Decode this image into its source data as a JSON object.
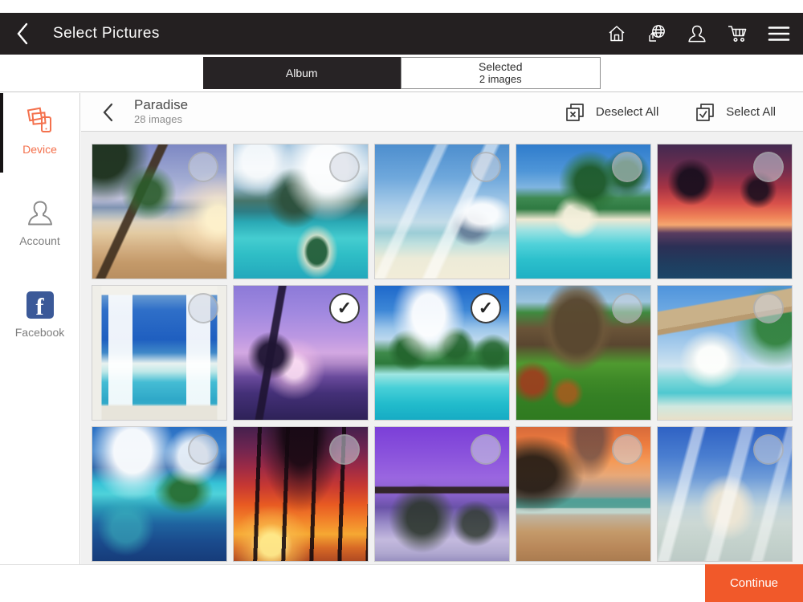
{
  "colors": {
    "accent": "#f1592a",
    "device_orange": "#f4714d",
    "facebook_blue": "#3b5998",
    "header_bg": "#242021",
    "grid_bg": "#f1f1f1"
  },
  "header": {
    "title": "Select Pictures",
    "icons": [
      "back-chevron-icon",
      "home-icon",
      "globe-upload-icon",
      "account-icon",
      "cart-icon",
      "menu-icon"
    ]
  },
  "tabs": {
    "album": {
      "label": "Album",
      "active": true
    },
    "selected": {
      "label": "Selected",
      "sublabel": "2 images",
      "active": false
    }
  },
  "sidebar": {
    "items": [
      {
        "label": "Device",
        "icon": "device-photos-icon",
        "active": true
      },
      {
        "label": "Account",
        "icon": "person-icon",
        "active": false
      },
      {
        "label": "Facebook",
        "icon": "facebook-icon",
        "active": false
      }
    ],
    "facebook_glyph": "f"
  },
  "album": {
    "name": "Paradise",
    "count_label": "28 images",
    "deselect_all_label": "Deselect All",
    "select_all_label": "Select All"
  },
  "grid": {
    "check_glyph": "✓",
    "selected_count": 2,
    "visible_count": 15
  },
  "footer": {
    "continue_label": "Continue"
  },
  "photos": [
    {
      "id": "palm-beach-sunrise",
      "alt": "palm tree leaning over golden beach",
      "selected": false,
      "bg": "radial-gradient(circle at 8% 8%, rgba(28,48,26,0.95) 0 13%, rgba(32,62,32,0.6) 18%, transparent 27%), radial-gradient(circle at 42% 36%, rgba(42,92,42,0.9) 0 10%, rgba(52,112,52,0.5) 16%, transparent 24%), linear-gradient(115deg, transparent 0 33%, rgba(62,46,30,0.9) 34% 38%, transparent 39%), radial-gradient(circle at 94% 55%, rgba(255,242,204,0.95) 0 8%, rgba(255,230,190,0.5) 18%, transparent 32%), linear-gradient(180deg, #7d88c4 0%, #a0aad2 25%, #c4c4de 40%, #8094b2 47%, #aab6c0 52%, #ded2bd 58%, #e3cba2 66%, #d5b286 76%, #c49a6a 88%, #b98f60 100%)"
    },
    {
      "id": "bora-bora-lagoon",
      "alt": "green mountain over turquoise lagoon",
      "selected": false,
      "bg": "radial-gradient(ellipse at 70% 18%, rgba(255,255,255,0.95) 0 15%, rgba(255,255,255,0.5) 24%, transparent 34%), radial-gradient(ellipse at 18% 12%, rgba(255,255,255,0.85) 0 10%, transparent 22%), radial-gradient(ellipse at 45% 40%, rgba(45,80,60,0.95) 0 12%, rgba(50,90,70,0.7) 18%, transparent 27%), radial-gradient(ellipse at 62% 80%, rgba(40,90,50,0.9) 0 8%, rgba(232,226,200,0.8) 11%, transparent 18%), linear-gradient(180deg, #9cc0dc 0%, #cfe0ec 18%, #8fb4c8 32%, #47756a 42%, #2e7d85 50%, #2aa9b5 58%, #45cdd0 70%, #2fbec6 82%, #23a8bc 100%)"
    },
    {
      "id": "beach-with-boat",
      "alt": "bright sky, distant hills, pale sand and boat",
      "selected": false,
      "bg": "linear-gradient(115deg, transparent 0 30%, rgba(255,255,255,0.5) 32% 36%, transparent 38% 55%, rgba(255,255,255,0.6) 57% 62%, transparent 64%), radial-gradient(ellipse at 80% 52%, rgba(255,255,255,0.9) 0 10%, transparent 20%), radial-gradient(ellipse at 72% 62%, rgba(92,112,142,0.8) 0 8%, transparent 16%), linear-gradient(180deg, #4d8ece 0%, #6fa8dc 25%, #a7cbe8 45%, #c3dce8 58%, #9ccdd6 66%, #bfe0de 74%, #ecebd8 85%, #f2ecd8 100%)"
    },
    {
      "id": "island-palms",
      "alt": "palms over white sand island and clear water",
      "selected": false,
      "bg": "radial-gradient(circle at 55% 28%, rgba(30,90,40,0.95) 0 12%, rgba(40,110,50,0.6) 18%, transparent 26%), radial-gradient(circle at 82% 22%, rgba(30,90,40,0.9) 0 8%, transparent 16%), radial-gradient(ellipse at 45% 54%, rgba(245,240,220,0.95) 0 12%, transparent 22%), linear-gradient(180deg, #2f7ccc 0%, #4f96d8 20%, #7fb4e0 32%, #3f8a52 40%, #2f7a42 48%, #eee8d2 56%, #9fe2e2 64%, #52d2da 74%, #2cc0cc 86%, #1fb0c4 100%)"
    },
    {
      "id": "pink-sunset-silhouette",
      "alt": "pink-orange sunset with palm silhouettes",
      "selected": false,
      "bg": "radial-gradient(circle at 25% 28%, rgba(25,15,30,0.95) 0 9%, transparent 17%), radial-gradient(circle at 75% 34%, rgba(25,15,30,0.9) 0 7%, transparent 14%), linear-gradient(180deg, #432a50 0%, #6e2c4e 18%, #a63344 32%, #d8504a 44%, #ef8258 54%, #f5a770 60%, #5a3c60 66%, #2c2f55 76%, #203c5e 88%, #1b4668 100%)"
    },
    {
      "id": "window-to-beach",
      "alt": "open white window onto blue sea",
      "selected": false,
      "bg": "linear-gradient(90deg, #efeee8 0 7%, transparent 7% 93%, #efeee8 93%), linear-gradient(180deg, #f2f1eb 0 7%, transparent 7% 88%, #e7e4da 90%), linear-gradient(90deg, transparent 0 12%, rgba(255,255,255,0.92) 12% 30%, transparent 30% 70%, rgba(255,255,255,0.92) 70% 88%, transparent 88%), linear-gradient(180deg, #8ab6d8 0%, #2f6fc8 18%, #1f5fc0 40%, #3f88c8 50%, #e8f2f0 58%, #bfe8e8 64%, #44bcd4 72%, #2fa8c8 85%, #3fb0cc 100%)"
    },
    {
      "id": "purple-sunset-palm",
      "alt": "violet sunset with palm silhouette",
      "selected": true,
      "bg": "radial-gradient(circle at 28% 52%, rgba(30,20,50,0.95) 0 10%, transparent 20%), linear-gradient(100deg, transparent 0 28%, rgba(30,20,50,0.9) 29% 33%, transparent 34%), radial-gradient(circle at 45% 62%, rgba(255,225,245,0.9) 0 8%, rgba(240,190,230,0.5) 16%, transparent 28%), linear-gradient(180deg, #8c7ad8 0%, #a38ae0 22%, #bb97e2 38%, #d3a8e2 50%, #b088c8 58%, #6a4a9c 68%, #443078 80%, #2e2258 100%)"
    },
    {
      "id": "palms-turquoise-water",
      "alt": "palms, clouds and turquoise water",
      "selected": true,
      "bg": "radial-gradient(ellipse at 40% 22%, rgba(255,255,255,0.95) 0 14%, rgba(255,255,255,0.5) 22%, transparent 32%), radial-gradient(circle at 25% 48%, rgba(35,100,45,0.95) 0 9%, transparent 17%), radial-gradient(circle at 60% 45%, rgba(35,100,45,0.9) 0 10%, transparent 18%), radial-gradient(circle at 88% 50%, rgba(35,100,45,0.85) 0 7%, transparent 14%), linear-gradient(180deg, #1e69cb 0%, #3c86d6 18%, #9cc6ea 32%, #bcd8ee 40%, #3e8a4a 50%, #2d7a3c 58%, #9fe6e2 66%, #48d0d8 76%, #22bccc 88%, #16abc4 100%)"
    },
    {
      "id": "thatched-hut",
      "alt": "thatched-roof hut with tropical plants",
      "selected": false,
      "bg": "radial-gradient(ellipse at 45% 30%, rgba(90,72,48,0.98) 0 20%, rgba(110,88,58,0.8) 26%, transparent 35%), radial-gradient(circle at 12% 72%, rgba(160,60,30,0.9) 0 7%, transparent 14%), radial-gradient(circle at 38% 80%, rgba(170,90,30,0.85) 0 6%, transparent 12%), linear-gradient(180deg, #7fb0d8 0%, #9cc4e0 12%, #3f8a3f 20%, #6a5438 32%, #5a4630 44%, #4f9a30 58%, #3f8a28 70%, #358024 82%, #2f7a20 100%)"
    },
    {
      "id": "hammock-palm",
      "alt": "white hammock on palm trunk over beach",
      "selected": false,
      "bg": "linear-gradient(170deg, transparent 0 16%, #c9b189 17% 28%, #b89a70 28% 31%, transparent 32%), radial-gradient(circle at 88% 30%, rgba(50,130,60,0.95) 0 12%, rgba(60,150,70,0.5) 18%, transparent 28%), radial-gradient(ellipse at 40% 55%, rgba(255,255,252,0.95) 0 12%, rgba(250,248,240,0.6) 18%, transparent 28%), linear-gradient(180deg, #4f94dc 0%, #77b0e4 25%, #a9cdec 45%, #cfe4f0 60%, #7fd8da 70%, #4fc8d0 80%, #cfe8e0 90%, #e8e0c8 100%)"
    },
    {
      "id": "aerial-lagoon-island",
      "alt": "aerial view of island, reef and deep blue sea",
      "selected": false,
      "bg": "radial-gradient(ellipse at 30% 18%, rgba(255,255,255,0.95) 0 14%, rgba(255,255,255,0.5) 22%, transparent 32%), radial-gradient(ellipse at 75% 22%, rgba(255,255,255,0.85) 0 10%, transparent 20%), radial-gradient(ellipse at 68% 48%, rgba(40,110,50,0.95) 0 10%, rgba(45,120,55,0.6) 15%, transparent 23%), radial-gradient(ellipse at 25% 75%, rgba(60,180,190,0.6) 0 10%, transparent 20%), linear-gradient(180deg, #2a70c4 0%, #3c82cc 18%, #2a62a8 30%, #35c2d6 42%, #4fd2da 50%, #2a9ab8 60%, #1f64a0 72%, #1a4a8c 86%, #163c7a 100%)"
    },
    {
      "id": "red-sunset-palm-trunks",
      "alt": "fiery sunset behind tall palm trunks",
      "selected": false,
      "bg": "radial-gradient(ellipse at 50% 4%, rgba(20,8,16,0.9) 0 18%, rgba(30,12,20,0.5) 28%, transparent 44%), repeating-linear-gradient(92deg, transparent 0 30px, rgba(18,8,14,0.88) 30px 35px), radial-gradient(circle at 28% 88%, rgba(255,235,140,0.95) 0 7%, rgba(250,190,80,0.6) 14%, transparent 26%), linear-gradient(180deg, #45204e 0%, #6e2550 16%, #9c2a46 30%, #c73832 44%, #e85a22 58%, #f2842a 70%, #f6a832 80%, #d86a26 90%, #b04a22 100%)"
    },
    {
      "id": "purple-mountain-bay",
      "alt": "violet-toned mountain bay with boats",
      "selected": false,
      "bg": "linear-gradient(180deg, transparent 0 44%, rgba(40,30,25,0.9) 45% 49%, transparent 50%), radial-gradient(ellipse at 35% 68%, rgba(45,55,45,0.9) 0 12%, rgba(55,65,55,0.6) 18%, transparent 27%), radial-gradient(ellipse at 75% 72%, rgba(50,60,50,0.85) 0 9%, transparent 17%), linear-gradient(180deg, #7b3fd8 0%, #8a52dc 20%, #9a66e0 38%, #8a62cc 50%, #6a52a8 60%, #9a8cc8 72%, #c4bade 84%, #b0a8d0 94%, #9890c0 100%)"
    },
    {
      "id": "sunset-cliff-beach",
      "alt": "orange sunset clouds over cliff and sand",
      "selected": false,
      "bg": "radial-gradient(ellipse at 55% 8%, rgba(90,70,70,0.7) 0 12%, transparent 24%), radial-gradient(ellipse at 12% 35%, rgba(40,30,22,0.95) 0 14%, rgba(50,38,28,0.7) 20%, transparent 31%), linear-gradient(180deg, transparent 0 52%, rgba(70,160,150,0.8) 54% 60%, rgba(200,230,225,0.7) 61% 64%, transparent 66%), linear-gradient(180deg, #d86a3a 0%, #ee7e40 14%, #f49a58 26%, #e8a878 36%, #b0988c 46%, #7a9a94 56%, #c0b4a0 66%, #c49a6a 78%, #b9885a 90%, #aa7c50 100%)"
    },
    {
      "id": "sandbar-umbrella",
      "alt": "white sandbar with umbrella in shallow sea",
      "selected": false,
      "bg": "linear-gradient(105deg, transparent 0 20%, rgba(255,255,255,0.55) 22% 27%, transparent 29% 48%, rgba(255,255,255,0.5) 50% 56%, transparent 58% 75%, rgba(255,255,255,0.45) 77% 82%, transparent 84%), radial-gradient(ellipse at 52% 60%, rgba(238,230,212,0.95) 0 14%, rgba(238,230,212,0.6) 20%, transparent 29%), linear-gradient(180deg, #2f62c4 0%, #4a7ed0 22%, #6f9cd8 38%, #9ebedd 50%, #c2d4da 60%, #ccd8d4 72%, #c4d2cc 86%, #bccac6 100%)"
    }
  ]
}
